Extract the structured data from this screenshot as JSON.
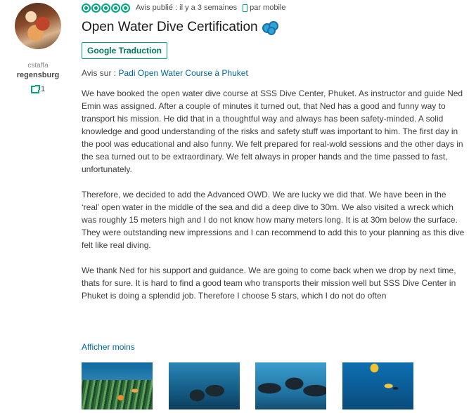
{
  "reviewer": {
    "name_small": "cstaffa",
    "location": "regensburg",
    "contributions": "1"
  },
  "review": {
    "rating": 5,
    "published": "Avis publié : il y a 3 semaines",
    "via": "par mobile",
    "title": "Open Water Dive Certification",
    "translate_label": "Google Traduction",
    "avis_sur_label": "Avis sur :",
    "product_link": "Padi Open Water Course à Phuket",
    "paragraphs": [
      "We have booked the open water dive course at SSS Dive Center, Phuket. As instructor and guide Ned Emin was assigned. After a couple of minutes it turned out, that Ned has a good and funny way to transport his mission. He did that in a thoughtful way and always has been safety-minded. A solid knowledge and good understanding of the risks and safety stuff was important to him. The first day in the pool was educational and also funny. We felt prepared for real-wold sessions and the other days in the sea turned out to be extraordinary. We felt always in proper hands and the time passed to fast, unfortunately.",
      "Therefore, we decided to add the Advanced OWD. We are lucky we did that. We have been in the ‘real’ open water in the middle of the sea and did a deep dive to 30m. We also visited a wreck which was roughly 15 meters high and I do not know how many meters long. It is at 30m below the surface. They were outstanding new impressions and I can recommend to add this to your planning as this dive felt like real diving.",
      "We thank Ned for his support and guidance. We are going to come back when we drop by next time, thats for sure. It is hard to find a good team who transports their mission well but SSS Dive Center in Phuket is doing a splendid job. Therefore I choose 5 stars, which I do not do often"
    ],
    "show_less": "Afficher moins"
  },
  "colors": {
    "accent": "#00a680",
    "link": "#006699"
  }
}
